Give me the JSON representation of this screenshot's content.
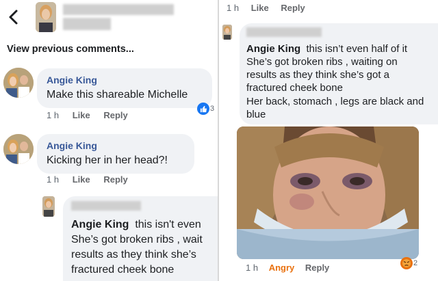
{
  "left": {
    "view_previous": "View previous comments...",
    "comments": [
      {
        "name": "Angie King",
        "text": "Make this shareable Michelle",
        "time": "1 h",
        "like": "Like",
        "reply": "Reply",
        "reaction_count": "3"
      },
      {
        "name": "Angie King",
        "text": "Kicking her in her head?!",
        "time": "1 h",
        "like": "Like",
        "reply": "Reply"
      }
    ],
    "reply": {
      "name": "Angie King",
      "lines": [
        "this isn't even",
        "She’s got broken ribs , wait",
        "results as they think she’s",
        "fractured cheek bone"
      ]
    }
  },
  "right": {
    "top_meta": {
      "time": "1 h",
      "like": "Like",
      "reply": "Reply"
    },
    "comment": {
      "name": "Angie King",
      "line1": "this isn’t even half of it",
      "lines": [
        "She’s got broken ribs , waiting on",
        "results as they think she’s got a",
        "fractured cheek bone",
        "Her back, stomach , legs are black and",
        "blue"
      ]
    },
    "bottom_meta": {
      "time": "1 h",
      "reaction": "Angry",
      "reply": "Reply",
      "reaction_count": "2"
    }
  },
  "colors": {
    "bubble": "#f0f2f5",
    "like_blue": "#1877f2",
    "angry_orange": "#e9710f",
    "meta_gray": "#606770"
  },
  "icons": [
    "back-arrow-icon",
    "like-reaction-icon",
    "angry-reaction-icon"
  ]
}
